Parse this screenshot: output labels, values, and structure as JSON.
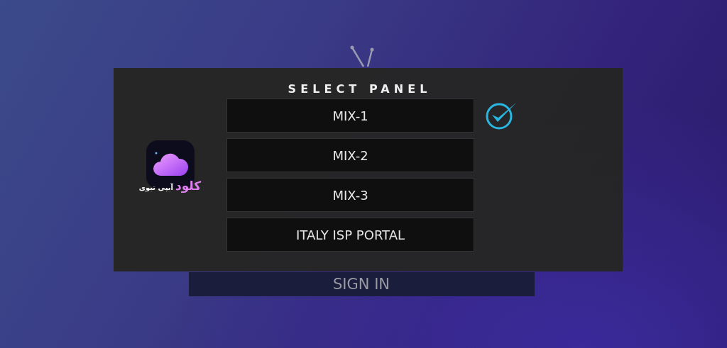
{
  "login": {
    "button": "SIGN IN"
  },
  "dialog": {
    "title": "SELECT PANEL",
    "logo": {
      "name": "کلود",
      "subtitle": "آیپی تیوی"
    },
    "options": [
      {
        "label": "MIX-1",
        "selected": true
      },
      {
        "label": "MIX-2",
        "selected": false
      },
      {
        "label": "MIX-3",
        "selected": false
      },
      {
        "label": "ITALY ISP PORTAL",
        "selected": false
      }
    ]
  }
}
